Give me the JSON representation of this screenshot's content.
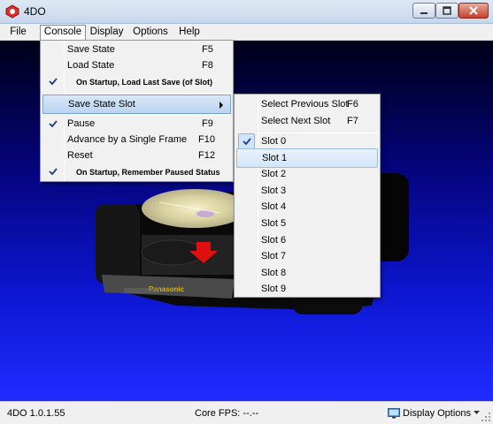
{
  "window": {
    "title": "4DO",
    "controls": {
      "minimize": "minimize",
      "maximize": "maximize",
      "close": "close"
    }
  },
  "menubar": {
    "items": [
      "File",
      "Console",
      "Display",
      "Options",
      "Help"
    ],
    "active": "Console"
  },
  "console_menu": {
    "save_state": {
      "label": "Save State",
      "shortcut": "F5"
    },
    "load_state": {
      "label": "Load State",
      "shortcut": "F8"
    },
    "on_startup_load": {
      "label": "On Startup, Load Last Save (of Slot)",
      "checked": true
    },
    "save_state_slot": {
      "label": "Save State Slot"
    },
    "pause": {
      "label": "Pause",
      "shortcut": "F9",
      "checked": true
    },
    "advance_frame": {
      "label": "Advance by a Single Frame",
      "shortcut": "F10"
    },
    "reset": {
      "label": "Reset",
      "shortcut": "F12"
    },
    "on_startup_paused": {
      "label": "On Startup, Remember Paused Status",
      "checked": true
    }
  },
  "slot_menu": {
    "select_previous": {
      "label": "Select Previous Slot",
      "shortcut": "F6"
    },
    "select_next": {
      "label": "Select Next Slot",
      "shortcut": "F7"
    },
    "slots": [
      "Slot 0",
      "Slot 1",
      "Slot 2",
      "Slot 3",
      "Slot 4",
      "Slot 5",
      "Slot 6",
      "Slot 7",
      "Slot 8",
      "Slot 9"
    ],
    "checked_slot": "Slot 0",
    "hovered_slot": "Slot 1"
  },
  "console_art": {
    "brand": "Panasonic"
  },
  "status": {
    "version": "4DO 1.0.1.55",
    "core_fps": "Core FPS: --.--",
    "display_options": "Display Options"
  },
  "colors": {
    "menu_highlight": "#d3e5f8",
    "check_background": "#cfe3f9",
    "viewport_blue": "#1f2cff"
  }
}
